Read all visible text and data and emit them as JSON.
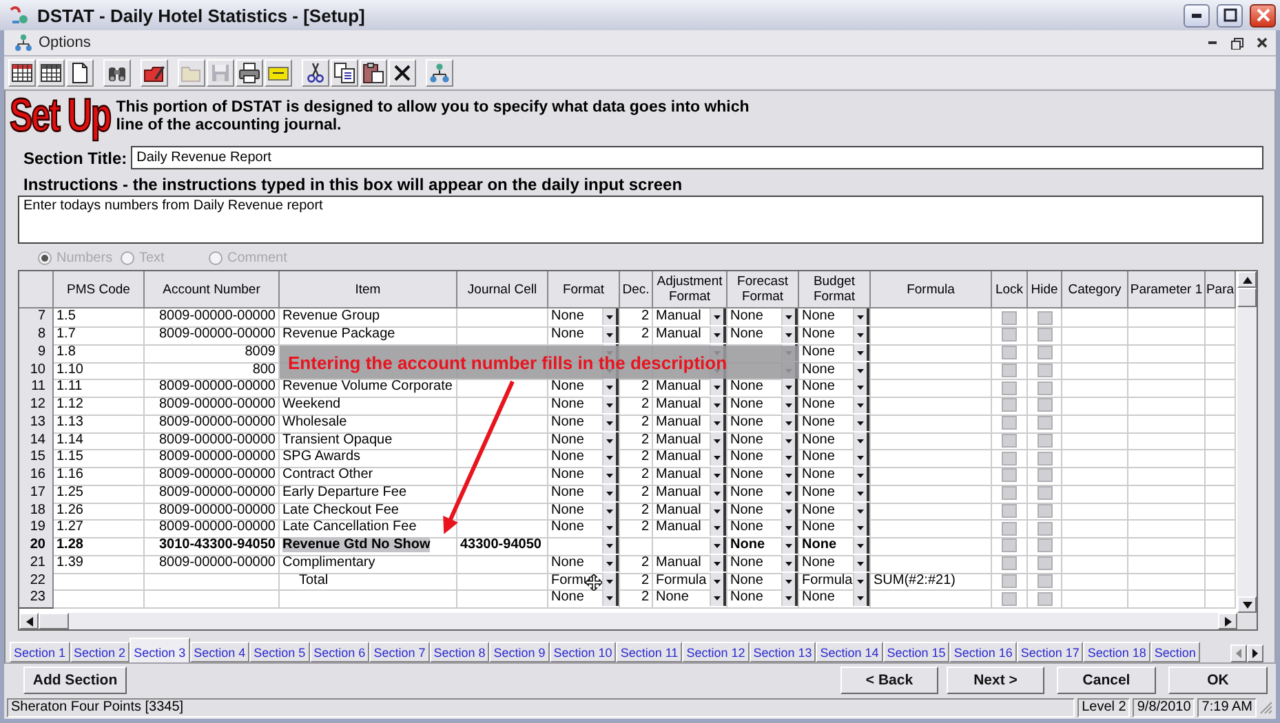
{
  "window": {
    "title": "DSTAT - Daily Hotel Statistics - [Setup]"
  },
  "menu_bar": {
    "items": [
      {
        "label": "Options"
      }
    ]
  },
  "toolbar": [
    [
      {
        "kind": "grid-red",
        "disabled": false
      },
      {
        "kind": "grid",
        "disabled": false
      },
      {
        "kind": "page",
        "disabled": false
      }
    ],
    [
      {
        "kind": "find",
        "disabled": false
      }
    ],
    [
      {
        "kind": "edit",
        "disabled": false
      }
    ],
    [
      {
        "kind": "open",
        "disabled": true
      },
      {
        "kind": "save",
        "disabled": true
      },
      {
        "kind": "print",
        "disabled": false
      },
      {
        "kind": "note",
        "disabled": false
      }
    ],
    [
      {
        "kind": "cut",
        "disabled": false
      },
      {
        "kind": "copy",
        "disabled": false
      },
      {
        "kind": "paste",
        "disabled": false
      },
      {
        "kind": "delete",
        "disabled": false
      }
    ],
    [
      {
        "kind": "tree",
        "disabled": false
      }
    ]
  ],
  "header": {
    "logo": "Set Up",
    "description": "This portion of DSTAT is designed to allow you to specify what data goes into which line of the accounting journal."
  },
  "section_title": {
    "label": "Section Title:",
    "value": "Daily Revenue Report"
  },
  "instructions": {
    "label": "Instructions - the instructions typed in this box will appear on the daily input screen",
    "value": "Enter todays numbers from Daily Revenue report"
  },
  "data_type": {
    "disabled": true,
    "options": [
      {
        "label": "Numbers",
        "selected": true
      },
      {
        "label": "Text",
        "selected": false
      },
      {
        "label": "Comment",
        "selected": false
      }
    ]
  },
  "table": {
    "columns": [
      "PMS Code",
      "Account Number",
      "Item",
      "Journal Cell",
      "Format",
      "Dec.",
      "Adjustment Format",
      "Forecast Format",
      "Budget Format",
      "Formula",
      "Lock",
      "Hide",
      "Category",
      "Parameter 1",
      "Para"
    ],
    "rows": [
      {
        "number": "7",
        "kind": "line",
        "selected": false,
        "pms_code": "1.5",
        "account": "8009-00000-00000",
        "item": "Revenue Group",
        "format": "None",
        "dec": "2",
        "adjustment_format": "Manual",
        "forecast_format": "None",
        "budget_format": "None",
        "lock": false,
        "hide": false
      },
      {
        "number": "8",
        "kind": "line",
        "selected": false,
        "pms_code": "1.7",
        "account": "8009-00000-00000",
        "item": "Revenue Package",
        "format": "None",
        "dec": "2",
        "adjustment_format": "Manual",
        "forecast_format": "None",
        "budget_format": "None",
        "lock": false,
        "hide": false
      },
      {
        "number": "9",
        "kind": "line",
        "selected": false,
        "pms_code": "1.8",
        "account": "8009",
        "budget_format": "None",
        "lock": false,
        "hide": false
      },
      {
        "number": "10",
        "kind": "line",
        "selected": false,
        "pms_code": "1.10",
        "account": "800",
        "budget_format": "None",
        "lock": false,
        "hide": false
      },
      {
        "number": "11",
        "kind": "line",
        "selected": false,
        "pms_code": "1.11",
        "account": "8009-00000-00000",
        "item": "Revenue Volume Corporate",
        "format": "None",
        "dec": "2",
        "adjustment_format": "Manual",
        "forecast_format": "None",
        "budget_format": "None",
        "lock": false,
        "hide": false
      },
      {
        "number": "12",
        "kind": "line",
        "selected": false,
        "pms_code": "1.12",
        "account": "8009-00000-00000",
        "item": "Weekend",
        "format": "None",
        "dec": "2",
        "adjustment_format": "Manual",
        "forecast_format": "None",
        "budget_format": "None",
        "lock": false,
        "hide": false
      },
      {
        "number": "13",
        "kind": "line",
        "selected": false,
        "pms_code": "1.13",
        "account": "8009-00000-00000",
        "item": "Wholesale",
        "format": "None",
        "dec": "2",
        "adjustment_format": "Manual",
        "forecast_format": "None",
        "budget_format": "None",
        "lock": false,
        "hide": false
      },
      {
        "number": "14",
        "kind": "line",
        "selected": false,
        "pms_code": "1.14",
        "account": "8009-00000-00000",
        "item": "Transient Opaque",
        "format": "None",
        "dec": "2",
        "adjustment_format": "Manual",
        "forecast_format": "None",
        "budget_format": "None",
        "lock": false,
        "hide": false
      },
      {
        "number": "15",
        "kind": "line",
        "selected": false,
        "pms_code": "1.15",
        "account": "8009-00000-00000",
        "item": "SPG Awards",
        "format": "None",
        "dec": "2",
        "adjustment_format": "Manual",
        "forecast_format": "None",
        "budget_format": "None",
        "lock": false,
        "hide": false
      },
      {
        "number": "16",
        "kind": "line",
        "selected": false,
        "pms_code": "1.16",
        "account": "8009-00000-00000",
        "item": "Contract Other",
        "format": "None",
        "dec": "2",
        "adjustment_format": "Manual",
        "forecast_format": "None",
        "budget_format": "None",
        "lock": false,
        "hide": false
      },
      {
        "number": "17",
        "kind": "line",
        "selected": false,
        "pms_code": "1.25",
        "account": "8009-00000-00000",
        "item": "Early Departure Fee",
        "format": "None",
        "dec": "2",
        "adjustment_format": "Manual",
        "forecast_format": "None",
        "budget_format": "None",
        "lock": false,
        "hide": false
      },
      {
        "number": "18",
        "kind": "line",
        "selected": false,
        "pms_code": "1.26",
        "account": "8009-00000-00000",
        "item": "Late Checkout Fee",
        "format": "None",
        "dec": "2",
        "adjustment_format": "Manual",
        "forecast_format": "None",
        "budget_format": "None",
        "lock": false,
        "hide": false
      },
      {
        "number": "19",
        "kind": "line",
        "selected": false,
        "pms_code": "1.27",
        "account": "8009-00000-00000",
        "item": "Late Cancellation Fee",
        "format": "None",
        "dec": "2",
        "adjustment_format": "Manual",
        "forecast_format": "None",
        "budget_format": "None",
        "lock": false,
        "hide": false
      },
      {
        "number": "20",
        "kind": "line",
        "selected": true,
        "pms_code": "1.28",
        "account": "3010-43300-94050",
        "item": "Revenue Gtd No Show",
        "journal_cell": "43300-94050",
        "forecast_format": "None",
        "budget_format": "None",
        "lock": false,
        "hide": false
      },
      {
        "number": "21",
        "kind": "line",
        "selected": false,
        "pms_code": "1.39",
        "account": "8009-00000-00000",
        "item": "Complimentary",
        "format": "None",
        "dec": "2",
        "adjustment_format": "Manual",
        "forecast_format": "None",
        "budget_format": "None",
        "lock": false,
        "hide": false
      },
      {
        "number": "22",
        "kind": "total",
        "selected": false,
        "item": "Total",
        "format": "Formu",
        "dec": "2",
        "adjustment_format": "Formula",
        "forecast_format": "None",
        "budget_format": "Formula",
        "formula": "SUM(#2:#21)",
        "lock": false,
        "hide": false
      },
      {
        "number": "23",
        "kind": "line",
        "selected": false,
        "format": "None",
        "dec": "2",
        "adjustment_format": "None",
        "forecast_format": "None",
        "budget_format": "None",
        "lock": false,
        "hide": false
      }
    ]
  },
  "annotation": {
    "text": "Entering the account number fills in the description"
  },
  "tabs": [
    {
      "label": "Section 1",
      "selected": false
    },
    {
      "label": "Section 2",
      "selected": false
    },
    {
      "label": "Section 3",
      "selected": true
    },
    {
      "label": "Section 4",
      "selected": false
    },
    {
      "label": "Section 5",
      "selected": false
    },
    {
      "label": "Section 6",
      "selected": false
    },
    {
      "label": "Section 7",
      "selected": false
    },
    {
      "label": "Section 8",
      "selected": false
    },
    {
      "label": "Section 9",
      "selected": false
    },
    {
      "label": "Section 10",
      "selected": false
    },
    {
      "label": "Section 11",
      "selected": false
    },
    {
      "label": "Section 12",
      "selected": false
    },
    {
      "label": "Section 13",
      "selected": false
    },
    {
      "label": "Section 14",
      "selected": false
    },
    {
      "label": "Section 15",
      "selected": false
    },
    {
      "label": "Section 16",
      "selected": false
    },
    {
      "label": "Section 17",
      "selected": false
    },
    {
      "label": "Section 18",
      "selected": false
    },
    {
      "label": "Section",
      "selected": false
    }
  ],
  "buttons": {
    "add": "Add Section",
    "nav": [
      "< Back",
      "Next >",
      "Cancel",
      "OK"
    ]
  },
  "status_bar": {
    "location": "Sheraton Four Points [3345]",
    "level": "Level 2",
    "date": "9/8/2010",
    "time": "7:19 AM"
  }
}
